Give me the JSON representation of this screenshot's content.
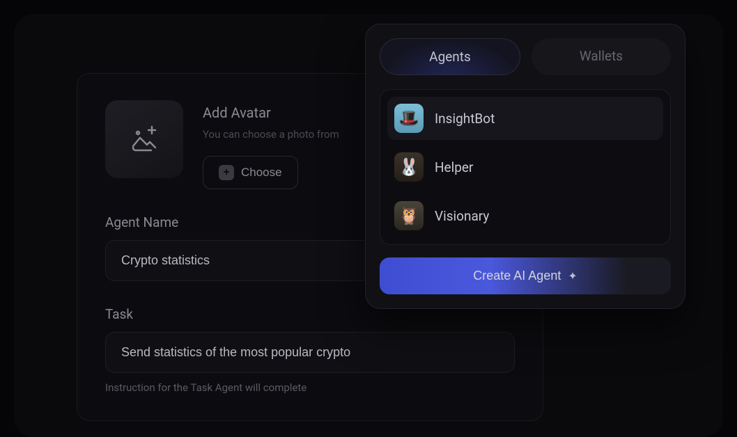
{
  "form": {
    "avatar": {
      "title": "Add Avatar",
      "subtitle": "You can choose a photo from",
      "choose_label": "Choose",
      "upload_icon": "image-add-icon"
    },
    "name": {
      "label": "Agent Name",
      "value": "Crypto statistics"
    },
    "task": {
      "label": "Task",
      "value": "Send statistics of the most popular crypto",
      "hint": "Instruction for the Task Agent will complete"
    }
  },
  "panel": {
    "tabs": {
      "agents": "Agents",
      "wallets": "Wallets",
      "active": "agents"
    },
    "agents": [
      {
        "name": "InsightBot",
        "avatar": "hat-face"
      },
      {
        "name": "Helper",
        "avatar": "rabbit"
      },
      {
        "name": "Visionary",
        "avatar": "owl-goggles"
      }
    ],
    "create_label": "Create AI Agent"
  }
}
